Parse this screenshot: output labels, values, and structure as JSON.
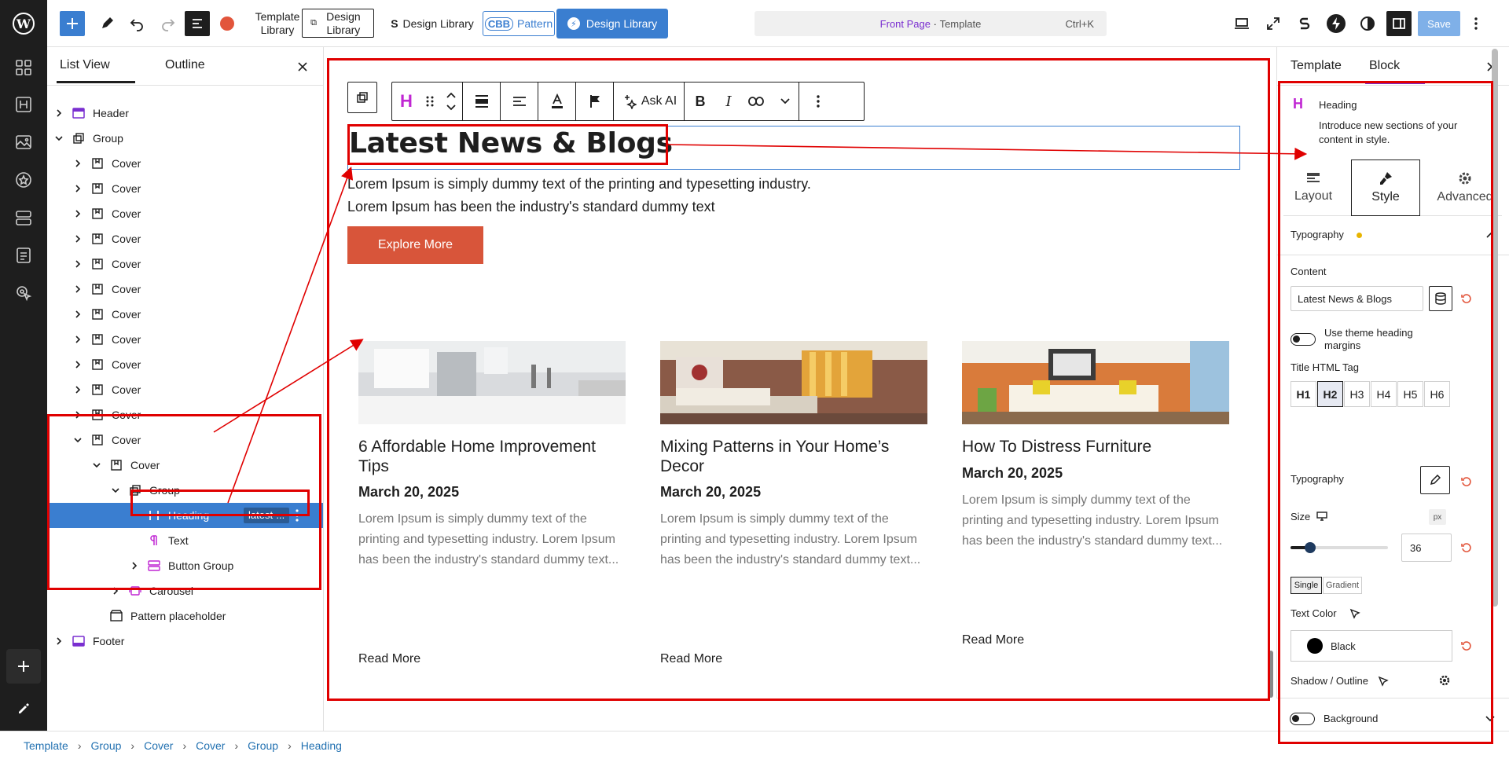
{
  "topbar": {
    "template_library_label": "Template Library",
    "design_library_label": "Design Library",
    "design_library_label2": "Design Library",
    "pattern_label": "Pattern",
    "cbb_badge": "CBB",
    "design_library_button": "Design Library",
    "command_title": "Front Page",
    "command_separator": " · ",
    "command_subtitle": "Template",
    "command_shortcut": "Ctrl+K",
    "save_label": "Save"
  },
  "list_panel": {
    "tab_list": "List View",
    "tab_outline": "Outline",
    "items": [
      {
        "label": "Header",
        "depth": 0,
        "icon": "header-block-icon",
        "expanded": false
      },
      {
        "label": "Group",
        "depth": 0,
        "icon": "group-block-icon",
        "expanded": true
      },
      {
        "label": "Cover",
        "depth": 1,
        "icon": "cover-block-icon",
        "expanded": false
      },
      {
        "label": "Cover",
        "depth": 1,
        "icon": "cover-block-icon",
        "expanded": false
      },
      {
        "label": "Cover",
        "depth": 1,
        "icon": "cover-block-icon",
        "expanded": false
      },
      {
        "label": "Cover",
        "depth": 1,
        "icon": "cover-block-icon",
        "expanded": false
      },
      {
        "label": "Cover",
        "depth": 1,
        "icon": "cover-block-icon",
        "expanded": false
      },
      {
        "label": "Cover",
        "depth": 1,
        "icon": "cover-block-icon",
        "expanded": false
      },
      {
        "label": "Cover",
        "depth": 1,
        "icon": "cover-block-icon",
        "expanded": false
      },
      {
        "label": "Cover",
        "depth": 1,
        "icon": "cover-block-icon",
        "expanded": false
      },
      {
        "label": "Cover",
        "depth": 1,
        "icon": "cover-block-icon",
        "expanded": false
      },
      {
        "label": "Cover",
        "depth": 1,
        "icon": "cover-block-icon",
        "expanded": false
      },
      {
        "label": "Cover",
        "depth": 1,
        "icon": "cover-block-icon",
        "expanded": false
      },
      {
        "label": "Cover",
        "depth": 1,
        "icon": "cover-block-icon",
        "expanded": true
      },
      {
        "label": "Cover",
        "depth": 2,
        "icon": "cover-block-icon",
        "expanded": true
      },
      {
        "label": "Group",
        "depth": 3,
        "icon": "group-block-icon",
        "expanded": true
      },
      {
        "label": "Heading",
        "depth": 4,
        "icon": "heading-block-icon",
        "expanded": null,
        "selected": true,
        "badge": "latest-..."
      },
      {
        "label": "Text",
        "depth": 4,
        "icon": "text-block-icon",
        "expanded": null
      },
      {
        "label": "Button Group",
        "depth": 4,
        "icon": "button-group-block-icon",
        "expanded": false
      },
      {
        "label": "Carousel",
        "depth": 3,
        "icon": "carousel-block-icon",
        "expanded": false
      },
      {
        "label": "Pattern placeholder",
        "depth": 2,
        "icon": "pattern-placeholder-icon",
        "expanded": null
      },
      {
        "label": "Footer",
        "depth": 0,
        "icon": "footer-block-icon",
        "expanded": false
      }
    ]
  },
  "canvas": {
    "toolbar_ask_ai": "Ask AI",
    "heading": "Latest News & Blogs",
    "intro_line1": "Lorem Ipsum is simply dummy text of the printing and typesetting industry.",
    "intro_line2": "Lorem Ipsum has been the industry's standard dummy text",
    "explore_button": "Explore More",
    "button_color": "#d8553a",
    "cards": [
      {
        "title": "6 Affordable Home Improvement Tips",
        "date": "March 20, 2025",
        "excerpt": "Lorem Ipsum is simply dummy text of the printing and typesetting industry. Lorem Ipsum has been the industry's standard dummy text...",
        "more": "Read More"
      },
      {
        "title": "Mixing Patterns in Your Home’s Decor",
        "date": "March 20, 2025",
        "excerpt": "Lorem Ipsum is simply dummy text of the printing and typesetting industry. Lorem Ipsum has been the industry's standard dummy text...",
        "more": "Read More"
      },
      {
        "title": "How To Distress Furniture",
        "date": "March 20, 2025",
        "excerpt": "Lorem Ipsum is simply dummy text of the printing and typesetting industry. Lorem Ipsum has been the industry's standard dummy text...",
        "more": "Read More"
      }
    ]
  },
  "right_panel": {
    "tab_template": "Template",
    "tab_block": "Block",
    "block_name": "Heading",
    "block_desc": "Introduce new sections of your content in style.",
    "subtab_layout": "Layout",
    "subtab_style": "Style",
    "subtab_advanced": "Advanced",
    "typography_section": "Typography",
    "content_label": "Content",
    "content_value": "Latest News & Blogs",
    "theme_margins_label": "Use theme heading margins",
    "title_tag_label": "Title HTML Tag",
    "tags": [
      "H1",
      "H2",
      "H3",
      "H4",
      "H5",
      "H6"
    ],
    "active_tag": "H2",
    "typography_label": "Typography",
    "size_label": "Size",
    "size_unit": "px",
    "size_value": "36",
    "size_level": 0.2,
    "single_label": "Single",
    "gradient_label": "Gradient",
    "text_color_label": "Text Color",
    "text_color_value": "Black",
    "shadow_label": "Shadow / Outline",
    "shadow_value": "",
    "background_label": "Background"
  },
  "breadcrumb": [
    "Template",
    "Group",
    "Cover",
    "Cover",
    "Group",
    "Heading"
  ],
  "colors": {
    "accent": "#3a7ed0",
    "wp_blue": "#3858e9",
    "annotation": "#e00000",
    "heading_pink": "#c026d3"
  }
}
